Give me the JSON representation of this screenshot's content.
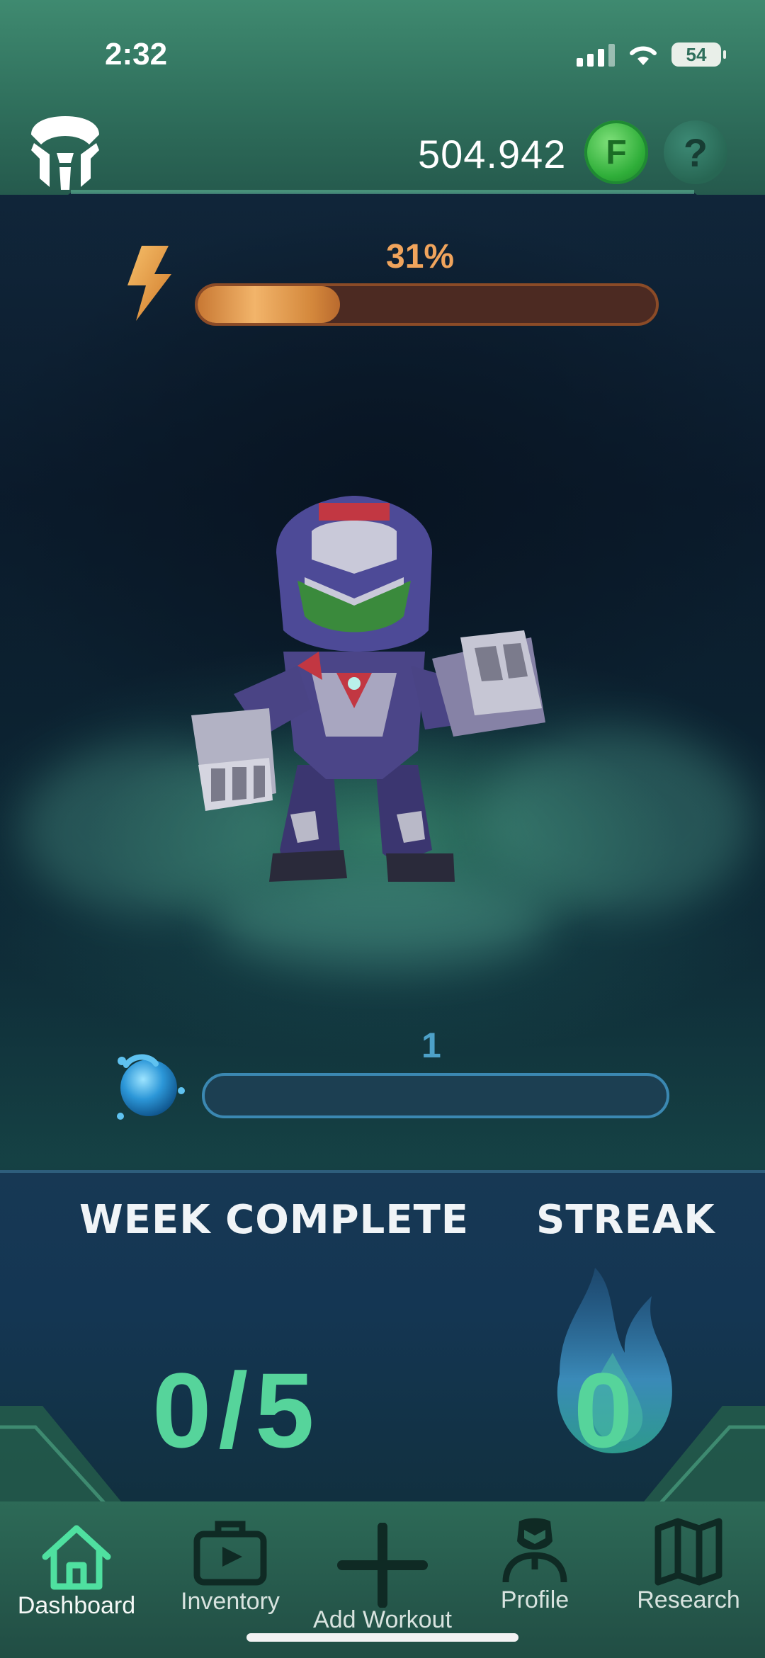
{
  "status_bar": {
    "time": "2:32",
    "battery": "54"
  },
  "header": {
    "currency_amount": "504.942",
    "coin_letter": "F",
    "help_symbol": "?",
    "logo_icon": "app-logo-icon"
  },
  "energy": {
    "percent_label": "31%",
    "level": 0.31,
    "color": "#f0a45c"
  },
  "experience": {
    "level": "1",
    "progress": 0
  },
  "stats": {
    "week_label": "WEEK COMPLETE",
    "week_value": "0/5",
    "streak_label": "STREAK",
    "streak_value": "0",
    "value_color": "#56d49b"
  },
  "nav": {
    "items": [
      {
        "label": "Dashboard",
        "icon": "home-icon",
        "active": true
      },
      {
        "label": "Inventory",
        "icon": "briefcase-icon"
      },
      {
        "label": "Add Workout",
        "icon": "plus-icon"
      },
      {
        "label": "Profile",
        "icon": "profile-icon"
      },
      {
        "label": "Research",
        "icon": "map-icon"
      }
    ]
  }
}
